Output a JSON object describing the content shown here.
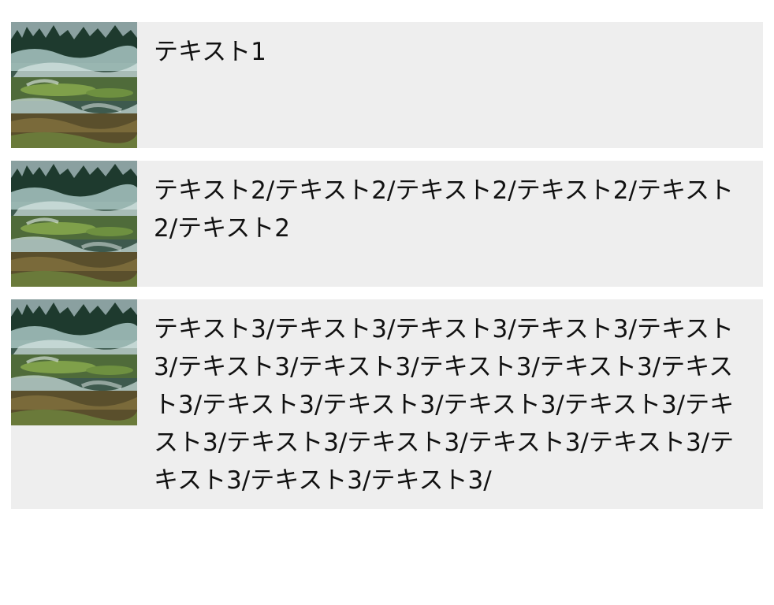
{
  "items": [
    {
      "text": "テキスト1",
      "image": "landscape-thumbnail"
    },
    {
      "text": "テキスト2/テキスト2/テキスト2/テキスト2/テキスト2/テキスト2",
      "image": "landscape-thumbnail"
    },
    {
      "text": "テキスト3/テキスト3/テキスト3/テキスト3/テキスト3/テキスト3/テキスト3/テキスト3/テキスト3/テキスト3/テキスト3/テキスト3/テキスト3/テキスト3/テキスト3/テキスト3/テキスト3/テキスト3/テキスト3/テキスト3/テキスト3/テキスト3/",
      "image": "landscape-thumbnail"
    }
  ]
}
